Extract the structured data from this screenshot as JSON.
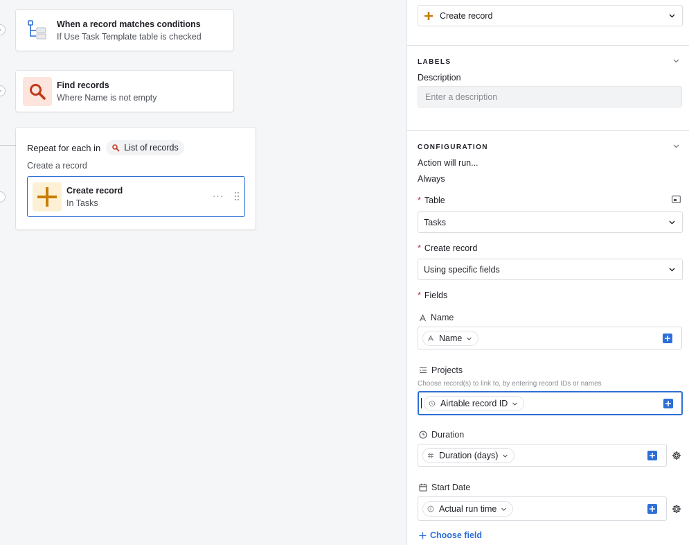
{
  "canvas": {
    "trigger_card": {
      "title": "When a record matches conditions",
      "subtitle": "If Use Task Template table is checked",
      "icon": "condition-branch-icon"
    },
    "find_card": {
      "title": "Find records",
      "subtitle": "Where Name is not empty",
      "icon": "search-icon",
      "icon_bg": "#fde4dc",
      "icon_color": "#c0391b"
    },
    "repeat_card": {
      "title": "Repeat for each in",
      "pill_label": "List of records",
      "subtitle": "Create a record",
      "inner": {
        "title": "Create record",
        "subtitle": "In Tasks",
        "icon": "plus-icon",
        "icon_bg": "#fdf0d5",
        "icon_color": "#c77d06",
        "more": "···"
      }
    }
  },
  "panel": {
    "action_select": {
      "label": "Create record",
      "icon": "plus-icon"
    },
    "labels_section": {
      "title": "LABELS",
      "description_label": "Description",
      "description_placeholder": "Enter a description"
    },
    "config_section": {
      "title": "CONFIGURATION",
      "run_label": "Action will run...",
      "run_value": "Always",
      "table_label": "Table",
      "table_value": "Tasks",
      "create_label": "Create record",
      "create_value": "Using specific fields",
      "fields_label": "Fields",
      "required_mark": "*"
    },
    "fields": [
      {
        "name": "Name",
        "icon": "text-field-icon",
        "token": "Name",
        "token_icon": "text-field-icon"
      },
      {
        "name": "Projects",
        "icon": "link-field-icon",
        "hint": "Choose record(s) to link to, by entering record IDs or names",
        "token": "Airtable record ID",
        "token_icon": "id-icon"
      },
      {
        "name": "Duration",
        "icon": "clock-icon",
        "token": "Duration (days)",
        "token_icon": "hash-icon"
      },
      {
        "name": "Start Date",
        "icon": "calendar-icon",
        "token": "Actual run time",
        "token_icon": "time-icon"
      }
    ],
    "choose_field_label": "Choose field",
    "accent_color": "#2d6fd6"
  }
}
